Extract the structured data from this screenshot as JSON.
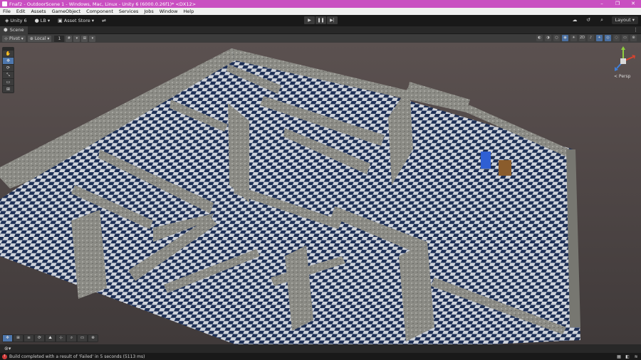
{
  "window": {
    "title": "Fnaf2 - OutdoorScene 1 - Windows, Mac, Linux - Unity 6 (6000.0.26f1)* <DX12>",
    "minimize": "–",
    "maximize": "❐",
    "close": "✕"
  },
  "menu": [
    "File",
    "Edit",
    "Assets",
    "GameObject",
    "Component",
    "Services",
    "Jobs",
    "Window",
    "Help"
  ],
  "toolbar": {
    "unity_label": "Unity 6",
    "account_label": "LB",
    "asset_store_label": "Asset Store",
    "play": "▶",
    "pause": "❚❚",
    "step": "▶|",
    "layout_label": "Layout"
  },
  "scene_tab": {
    "label": "Scene",
    "more": "⋮"
  },
  "scene_toolbar": {
    "pivot_label": "Pivot",
    "local_label": "Local",
    "grid_value": "1"
  },
  "tools": [
    "✋",
    "✥",
    "⟳",
    "⤡",
    "▭",
    "⊞"
  ],
  "gizmo": {
    "persp_label": "< Persp",
    "x_color": "#d9432f",
    "y_color": "#8fcf3f",
    "z_color": "#3f7fd9"
  },
  "status": {
    "message": "Build completed with a result of 'Failed' in 5 seconds (5113 ms)",
    "error_color": "#d23a3a"
  }
}
